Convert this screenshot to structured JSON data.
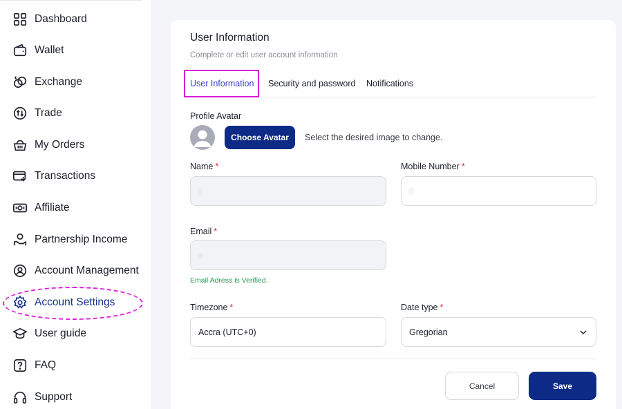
{
  "sidebar": {
    "items": [
      {
        "label": "Dashboard",
        "icon": "dashboard-icon"
      },
      {
        "label": "Wallet",
        "icon": "wallet-icon"
      },
      {
        "label": "Exchange",
        "icon": "exchange-icon"
      },
      {
        "label": "Trade",
        "icon": "trade-icon"
      },
      {
        "label": "My Orders",
        "icon": "orders-basket-icon"
      },
      {
        "label": "Transactions",
        "icon": "transactions-card-icon"
      },
      {
        "label": "Affiliate",
        "icon": "affiliate-icon"
      },
      {
        "label": "Partnership Income",
        "icon": "partnership-hand-icon"
      },
      {
        "label": "Account Management",
        "icon": "user-circle-icon"
      },
      {
        "label": "Account Settings",
        "icon": "gear-icon",
        "active": true
      },
      {
        "label": "User guide",
        "icon": "graduation-cap-icon"
      },
      {
        "label": "FAQ",
        "icon": "question-icon"
      },
      {
        "label": "Support",
        "icon": "headphones-icon"
      }
    ]
  },
  "card": {
    "title": "User Information",
    "subtitle": "Complete or edit user account information"
  },
  "tabs": [
    {
      "label": "User Information",
      "active": true
    },
    {
      "label": "Security and password"
    },
    {
      "label": "Notifications"
    }
  ],
  "form": {
    "avatar_label": "Profile Avatar",
    "choose_avatar_label": "Choose Avatar",
    "avatar_hint": "Select the desired image to change.",
    "name_label": "Name",
    "name_value": "t",
    "mobile_label": "Mobile Number",
    "mobile_value": "0",
    "email_label": "Email",
    "email_value": "e",
    "email_status": "Email Adress is Verified.",
    "timezone_label": "Timezone",
    "timezone_value": "Accra (UTC+0)",
    "date_type_label": "Date type",
    "date_type_value": "Gregorian",
    "required_mark": "*"
  },
  "actions": {
    "cancel_label": "Cancel",
    "save_label": "Save"
  },
  "colors": {
    "primary": "#0d2a86",
    "active_nav": "#14308f",
    "active_tab": "#3a3fbf",
    "verified": "#1f9a57",
    "required": "#e0283a",
    "annotation": "#e01be0"
  }
}
